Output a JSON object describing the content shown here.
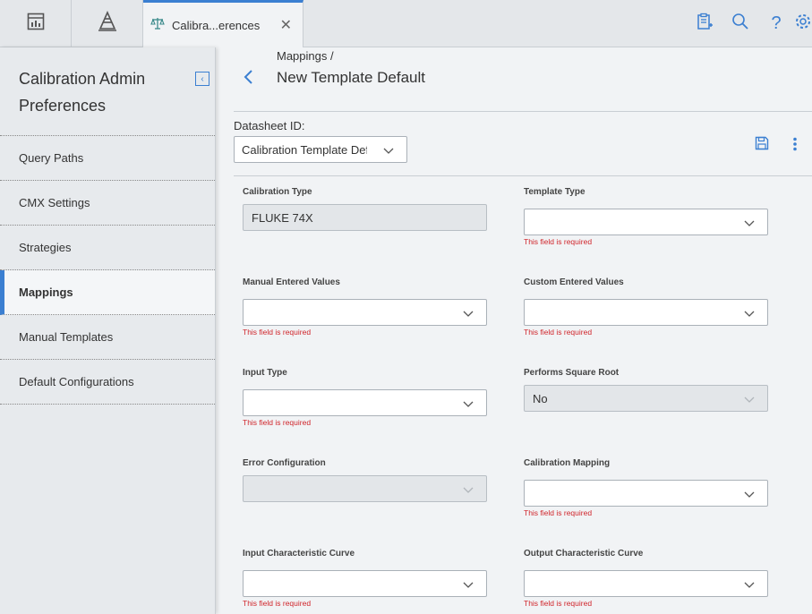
{
  "topbar": {
    "tab_label": "Calibra...erences",
    "icons": [
      "dashboard-icon",
      "hierarchy-icon",
      "scale-icon",
      "close-icon",
      "clipboard-icon",
      "search-icon",
      "help-icon",
      "settings-icon"
    ],
    "help_glyph": "?",
    "close_glyph": "✕"
  },
  "sidebar": {
    "title": "Calibration Admin Preferences",
    "items": [
      {
        "label": "Query Paths"
      },
      {
        "label": "CMX Settings"
      },
      {
        "label": "Strategies"
      },
      {
        "label": "Mappings"
      },
      {
        "label": "Manual Templates"
      },
      {
        "label": "Default Configurations"
      }
    ],
    "active_item": "Mappings"
  },
  "main": {
    "breadcrumb": "Mappings /",
    "title": "New Template Default",
    "datasheet_label": "Datasheet ID:",
    "datasheet_value": "Calibration Template Default",
    "fields": {
      "calibration_type": {
        "label": "Calibration Type",
        "value": "FLUKE 74X"
      },
      "template_type": {
        "label": "Template Type",
        "value": "",
        "error": "This field is required"
      },
      "manual_entered_values": {
        "label": "Manual Entered Values",
        "value": "",
        "error": "This field is required"
      },
      "custom_entered_values": {
        "label": "Custom Entered Values",
        "value": "",
        "error": "This field is required"
      },
      "input_type": {
        "label": "Input Type",
        "value": "",
        "error": "This field is required"
      },
      "performs_square_root": {
        "label": "Performs Square Root",
        "value": "No"
      },
      "error_configuration": {
        "label": "Error Configuration",
        "value": ""
      },
      "calibration_mapping": {
        "label": "Calibration Mapping",
        "value": "",
        "error": "This field is required"
      },
      "input_characteristic_curve": {
        "label": "Input Characteristic Curve",
        "value": "",
        "error": "This field is required"
      },
      "output_characteristic_curve": {
        "label": "Output Characteristic Curve",
        "value": "",
        "error": "This field is required"
      }
    }
  },
  "colors": {
    "accent": "#3b7fd1",
    "error": "#d0252b",
    "sidebar_bg": "#e7eaed",
    "main_bg": "#f1f3f5"
  }
}
